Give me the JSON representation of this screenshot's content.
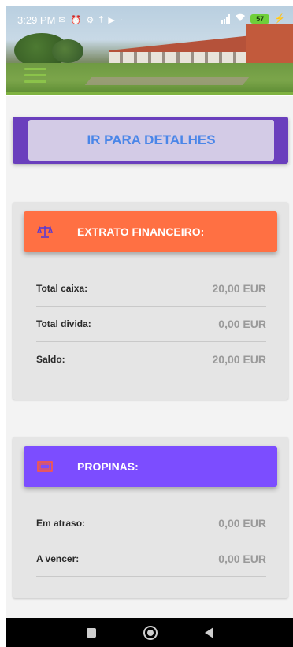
{
  "status_bar": {
    "time": "3:29 PM",
    "left_icons": [
      "notification-icon",
      "alarm-icon",
      "settings-icon",
      "usb-icon",
      "youtube-icon"
    ],
    "battery": "57"
  },
  "details_button": {
    "label": "IR PARA DETALHES"
  },
  "extrato": {
    "title": "EXTRATO FINANCEIRO:",
    "icon": "scale-icon",
    "header_color": "#ff7043",
    "rows": [
      {
        "label": "Total caixa:",
        "value": "20,00 EUR"
      },
      {
        "label": "Total divida:",
        "value": "0,00 EUR"
      },
      {
        "label": "Saldo:",
        "value": "20,00 EUR"
      }
    ]
  },
  "propinas": {
    "title": "PROPINAS:",
    "icon": "cash-icon",
    "header_color": "#7c4dff",
    "rows": [
      {
        "label": "Em atraso:",
        "value": "0,00 EUR"
      },
      {
        "label": "A vencer:",
        "value": "0,00 EUR"
      }
    ]
  },
  "colors": {
    "accent_purple": "#6a3fbd",
    "details_label": "#4a86e8",
    "menu_green": "#8bc34a"
  }
}
